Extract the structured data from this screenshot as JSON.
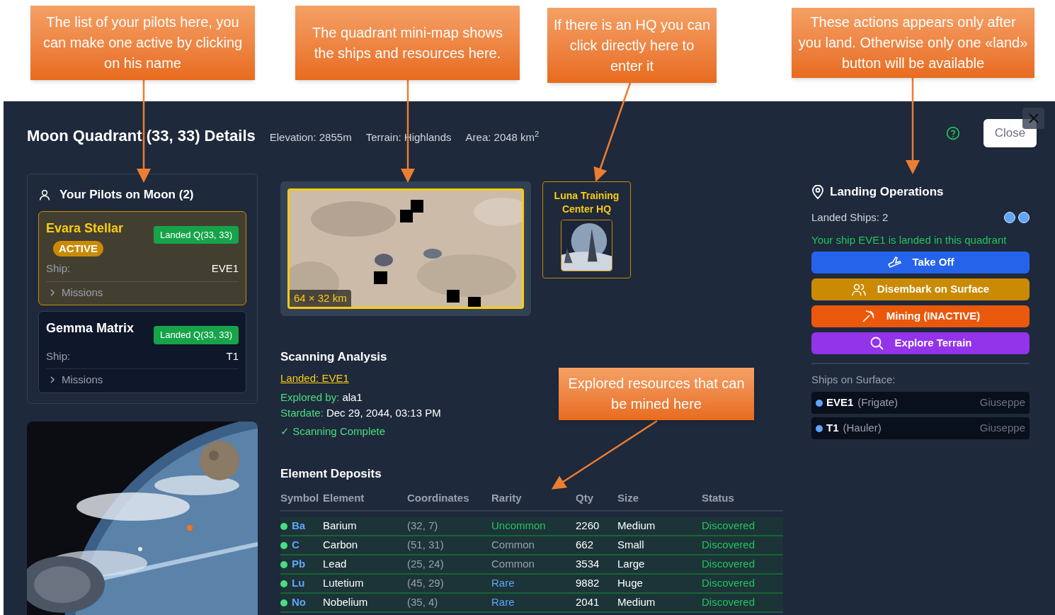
{
  "callouts": [
    {
      "text": "The list of your pilots here, you can make one active by clicking on his name"
    },
    {
      "text": "The quadrant mini-map shows the ships and resources here."
    },
    {
      "text": "If there is an HQ you can click directly here to enter it"
    },
    {
      "text": "These actions appears only after you land. Otherwise only one «land» button will be available"
    },
    {
      "text": "Explored resources  that can be mined here"
    }
  ],
  "header": {
    "title": "Moon Quadrant (33, 33) Details",
    "stats": [
      "Elevation: 2855m",
      "Terrain: Highlands",
      "Area: 2048 km$^{2}$"
    ],
    "close_label": "Close"
  },
  "pilots_panel": {
    "title": "Your Pilots on Moon (2)",
    "pilots": [
      {
        "name": "Evara Stellar",
        "selected": true,
        "active_badge": "ACTIVE",
        "status": "Landed Q(33, 33)",
        "ship_label": "Ship:",
        "ship": "EVE1",
        "missions": "Missions",
        "expanded": false
      },
      {
        "name": "Gemma Matrix",
        "selected": false,
        "status": "Landed Q(33, 33)",
        "ship_label": "Ship:",
        "ship": "T1",
        "missions": "Missions",
        "expanded": false
      }
    ]
  },
  "minimap": {
    "scale": "64 × 32 km"
  },
  "hq": {
    "name": "Luna Training Center HQ"
  },
  "scanning": {
    "title": "Scanning Analysis",
    "landed_link": "Landed: EVE1",
    "explored_label": "Explored by:",
    "explored_value": "ala1",
    "stardate_label": "Stardate:",
    "stardate_value": "Dec 29, 2044, 03:13 PM",
    "complete": "✓ Scanning Complete"
  },
  "deposits": {
    "title": "Element Deposits",
    "columns": [
      "Symbol",
      "Element",
      "Coordinates",
      "Rarity",
      "Qty",
      "Size",
      "Status"
    ],
    "rows": [
      {
        "symbol": "Ba",
        "element": "Barium",
        "coordinates": "(32, 7)",
        "rarity": "Uncommon",
        "kind": "positive",
        "qty": "2260",
        "size": "Medium",
        "status": "Discovered"
      },
      {
        "symbol": "C",
        "element": "Carbon",
        "coordinates": "(51, 31)",
        "rarity": "Common",
        "kind": "muted",
        "qty": "662",
        "size": "Small",
        "status": "Discovered"
      },
      {
        "symbol": "Pb",
        "element": "Lead",
        "coordinates": "(25, 24)",
        "rarity": "Common",
        "kind": "muted",
        "qty": "3534",
        "size": "Large",
        "status": "Discovered"
      },
      {
        "symbol": "Lu",
        "element": "Lutetium",
        "coordinates": "(45, 29)",
        "rarity": "Rare",
        "kind": "info",
        "qty": "9882",
        "size": "Huge",
        "status": "Discovered"
      },
      {
        "symbol": "No",
        "element": "Nobelium",
        "coordinates": "(35, 4)",
        "rarity": "Rare",
        "kind": "info",
        "qty": "2041",
        "size": "Medium",
        "status": "Discovered"
      }
    ]
  },
  "landing": {
    "title": "Landing Operations",
    "landed_count": "Landed Ships: 2",
    "notice": "Your ship EVE1 is landed in this quadrant",
    "actions": [
      {
        "label": "Take Off",
        "kind": "takeoff",
        "color": "#2563eb"
      },
      {
        "label": "Disembark on Surface",
        "kind": "people",
        "color": "#ca8a04"
      },
      {
        "label": "Mining (INACTIVE)",
        "kind": "pickaxe",
        "color": "#ea580c"
      },
      {
        "label": "Explore Terrain",
        "kind": "search",
        "color": "#9333ea"
      }
    ],
    "surface_title": "Ships on Surface:",
    "surface_ships": [
      {
        "name": "EVE1",
        "type": "(Frigate)",
        "owner": "Giuseppe",
        "color": "#60a5fa"
      },
      {
        "name": "T1",
        "type": "(Hauler)",
        "owner": "Giuseppe",
        "color": "#60a5fa"
      }
    ]
  }
}
